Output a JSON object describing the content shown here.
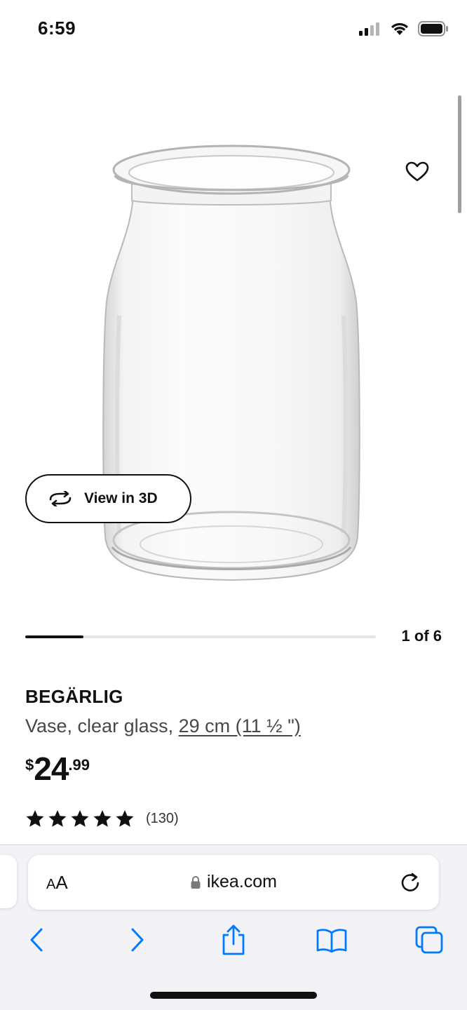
{
  "status_bar": {
    "time": "6:59",
    "signal_icon": "cellular-signal-icon",
    "wifi_icon": "wifi-icon",
    "battery_icon": "battery-icon"
  },
  "gallery": {
    "image_icon": "vase-product-image",
    "favorite_icon": "heart-icon",
    "view_3d_label": "View in 3D",
    "view_3d_icon": "rotate-3d-icon",
    "carousel_progress_fraction": 0.1667,
    "page_indicator": "1 of 6"
  },
  "product": {
    "name": "BEGÄRLIG",
    "description": "Vase, clear glass,",
    "measurement": "29 cm (11 ½ \")",
    "price": {
      "currency": "$",
      "integer": "24",
      "decimal": ".99"
    },
    "rating": {
      "stars": 5,
      "max_stars": 5,
      "count": "(130)"
    }
  },
  "browser": {
    "text_size_label_small": "A",
    "text_size_label_large": "A",
    "lock_icon": "lock-icon",
    "url": "ikea.com",
    "reload_icon": "reload-icon",
    "toolbar": {
      "back_icon": "chevron-left-icon",
      "forward_icon": "chevron-right-icon",
      "share_icon": "share-icon",
      "bookmarks_icon": "book-icon",
      "tabs_icon": "tabs-icon"
    },
    "accent_color": "#007aff"
  }
}
